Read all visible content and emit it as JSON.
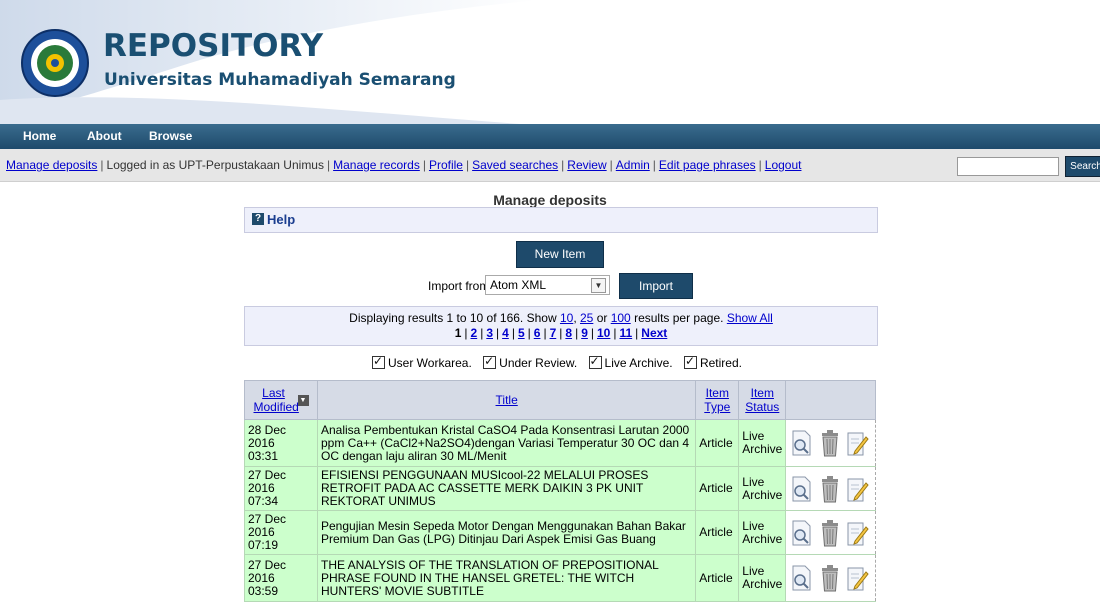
{
  "brand": {
    "title": "REPOSITORY",
    "subtitle": "Universitas Muhamadiyah Semarang"
  },
  "nav": [
    "Home",
    "About",
    "Browse"
  ],
  "toolbar": {
    "manage_deposits": "Manage deposits",
    "logged_in": "Logged in as UPT-Perpustakaan Unimus",
    "links": [
      "Manage records",
      "Profile",
      "Saved searches",
      "Review",
      "Admin",
      "Edit page phrases",
      "Logout"
    ],
    "search_value": "",
    "search_label": "Search"
  },
  "page": {
    "title": "Manage deposits",
    "help_label": "Help",
    "new_item_label": "New Item",
    "import_from_label": "Import from",
    "import_selected": "Atom XML",
    "import_button": "Import"
  },
  "pager": {
    "text_prefix": "Displaying results 1 to 10 of 166. Show",
    "opt_10": "10",
    "opt_25": "25",
    "or_text": "or",
    "opt_100": "100",
    "per_page_text": "results per page.",
    "show_all": "Show All",
    "current": "1",
    "pages": [
      "2",
      "3",
      "4",
      "5",
      "6",
      "7",
      "8",
      "9",
      "10",
      "11"
    ],
    "next": "Next"
  },
  "filters": [
    "User Workarea.",
    "Under Review.",
    "Live Archive.",
    "Retired."
  ],
  "table": {
    "headers": {
      "last_modified": "Last Modified",
      "title": "Title",
      "item_type": "Item Type",
      "item_status": "Item Status"
    },
    "rows": [
      {
        "date": "28 Dec 2016",
        "time": "03:31",
        "title": "Analisa Pembentukan Kristal CaSO4 Pada Konsentrasi Larutan 2000 ppm Ca++ (CaCl2+Na2SO4)dengan Variasi Temperatur 30 OC dan 4 OC dengan laju aliran 30 ML/Menit",
        "type": "Article",
        "status_1": "Live",
        "status_2": "Archive"
      },
      {
        "date": "27 Dec 2016",
        "time": "07:34",
        "title": "EFISIENSI PENGGUNAAN MUSIcool-22 MELALUI PROSES RETROFIT PADA AC CASSETTE MERK DAIKIN 3 PK UNIT REKTORAT UNIMUS",
        "type": "Article",
        "status_1": "Live",
        "status_2": "Archive"
      },
      {
        "date": "27 Dec 2016",
        "time": "07:19",
        "title": "Pengujian Mesin Sepeda Motor Dengan Menggunakan Bahan Bakar Premium Dan Gas (LPG) Ditinjau Dari Aspek Emisi Gas Buang",
        "type": "Article",
        "status_1": "Live",
        "status_2": "Archive"
      },
      {
        "date": "27 Dec 2016",
        "time": "03:59",
        "title": "THE ANALYSIS OF THE TRANSLATION OF PREPOSITIONAL PHRASE FOUND IN THE HANSEL GRETEL: THE WITCH HUNTERS' MOVIE SUBTITLE",
        "type": "Article",
        "status_1": "Live",
        "status_2": "Archive"
      }
    ]
  },
  "colors": {
    "brand_blue": "#1a4f72",
    "nav_bg": "#1e4a6b",
    "row_green": "#ccffcc",
    "link_blue": "#0000cc"
  },
  "icons": [
    "university-seal-logo",
    "help-icon",
    "sort-desc-icon",
    "view-icon",
    "delete-icon",
    "edit-icon",
    "chevron-down-icon"
  ]
}
